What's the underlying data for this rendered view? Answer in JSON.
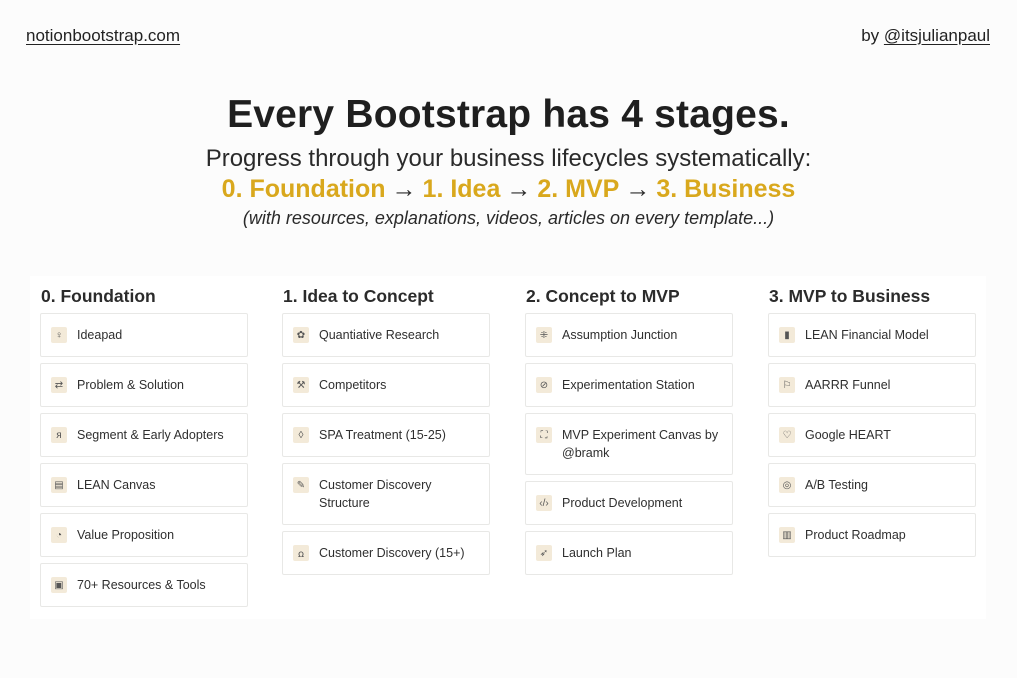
{
  "header": {
    "site_link": "notionbootstrap.com",
    "by_prefix": "by ",
    "author_link": "@itsjulianpaul"
  },
  "hero": {
    "title": "Every Bootstrap has 4 stages.",
    "subtitle": "Progress through your business lifecycles systematically:",
    "stages": [
      "0. Foundation",
      "1. Idea",
      "2. MVP",
      "3. Business"
    ],
    "arrow": "→",
    "note": "(with resources, explanations, videos, articles on every template...)",
    "accent_color": "#d9a81d"
  },
  "columns": [
    {
      "title": "0. Foundation",
      "items": [
        {
          "label": "Ideapad",
          "icon": "lightbulb-icon",
          "glyph": "♀"
        },
        {
          "label": "Problem & Solution",
          "icon": "arrows-exchange-icon",
          "glyph": "⇄"
        },
        {
          "label": "Segment & Early Adopters",
          "icon": "person-icon",
          "glyph": "ᴙ"
        },
        {
          "label": "LEAN Canvas",
          "icon": "layout-icon",
          "glyph": "▤"
        },
        {
          "label": "Value Proposition",
          "icon": "pie-chart-icon",
          "glyph": "◔"
        },
        {
          "label": "70+ Resources & Tools",
          "icon": "archive-icon",
          "glyph": "▣"
        }
      ]
    },
    {
      "title": "1. Idea to Concept",
      "items": [
        {
          "label": "Quantiative Research",
          "icon": "puzzle-icon",
          "glyph": "✿"
        },
        {
          "label": "Competitors",
          "icon": "crossed-tools-icon",
          "glyph": "⚒"
        },
        {
          "label": "SPA Treatment (15-25)",
          "icon": "drop-icon",
          "glyph": "◊"
        },
        {
          "label": "Customer Discovery Structure",
          "icon": "feather-icon",
          "glyph": "✎"
        },
        {
          "label": "Customer Discovery (15+)",
          "icon": "people-icon",
          "glyph": "ꭥ"
        }
      ]
    },
    {
      "title": "2. Concept to MVP",
      "items": [
        {
          "label": "Assumption Junction",
          "icon": "collapse-icon",
          "glyph": "⁜"
        },
        {
          "label": "Experimentation Station",
          "icon": "check-badge-icon",
          "glyph": "⊘"
        },
        {
          "label": "MVP Experiment Canvas by @bramk",
          "icon": "frame-icon",
          "glyph": "⛶"
        },
        {
          "label": "Product Development",
          "icon": "code-icon",
          "glyph": "‹/›"
        },
        {
          "label": "Launch Plan",
          "icon": "rocket-icon",
          "glyph": "➶"
        }
      ]
    },
    {
      "title": "3. MVP to Business",
      "items": [
        {
          "label": "LEAN Financial Model",
          "icon": "bar-chart-icon",
          "glyph": "▮"
        },
        {
          "label": "AARRR Funnel",
          "icon": "flag-icon",
          "glyph": "⚐"
        },
        {
          "label": "Google HEART",
          "icon": "heart-icon",
          "glyph": "♡"
        },
        {
          "label": "A/B Testing",
          "icon": "circles-icon",
          "glyph": "◎"
        },
        {
          "label": "Product Roadmap",
          "icon": "map-icon",
          "glyph": "▥"
        }
      ]
    }
  ]
}
